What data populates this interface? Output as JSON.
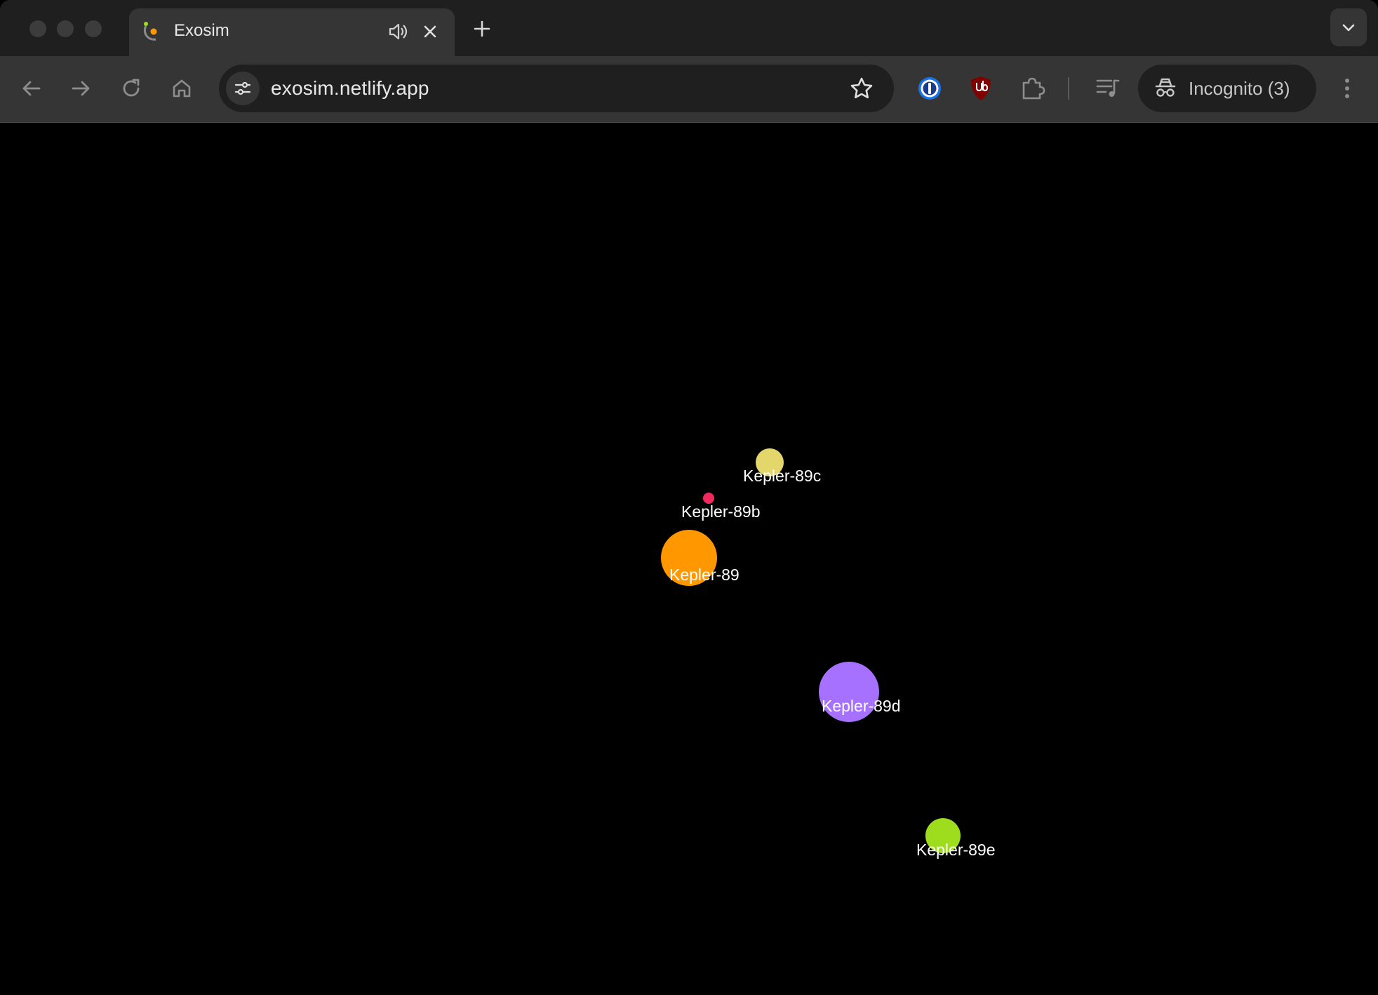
{
  "browser": {
    "tab": {
      "title": "Exosim",
      "favicon": "exosim-orbit-icon",
      "audio_icon": "speaker-icon",
      "close_icon": "close-icon"
    },
    "new_tab_icon": "plus-icon",
    "tab_search_icon": "chevron-down-icon",
    "nav": {
      "back_icon": "back-arrow-icon",
      "forward_icon": "forward-arrow-icon",
      "reload_icon": "reload-icon",
      "home_icon": "home-icon"
    },
    "address_bar": {
      "url": "exosim.netlify.app",
      "site_info_icon": "tune-icon",
      "bookmark_icon": "star-icon"
    },
    "extensions": [
      "1password-icon",
      "ublock-origin-icon",
      "puzzle-extensions-icon",
      "media-controls-icon"
    ],
    "incognito": {
      "label": "Incognito (3)",
      "icon": "incognito-icon"
    },
    "menu_icon": "kebab-menu-icon"
  },
  "simulation": {
    "background": "#000000",
    "bodies": [
      {
        "name": "Kepler-89c",
        "kind": "planet",
        "color": "#e3d66b"
      },
      {
        "name": "Kepler-89b",
        "kind": "planet",
        "color": "#f0295f"
      },
      {
        "name": "Kepler-89",
        "kind": "star",
        "color": "#ff9800"
      },
      {
        "name": "Kepler-89d",
        "kind": "planet",
        "color": "#a771ff"
      },
      {
        "name": "Kepler-89e",
        "kind": "planet",
        "color": "#9edd1e"
      }
    ]
  }
}
